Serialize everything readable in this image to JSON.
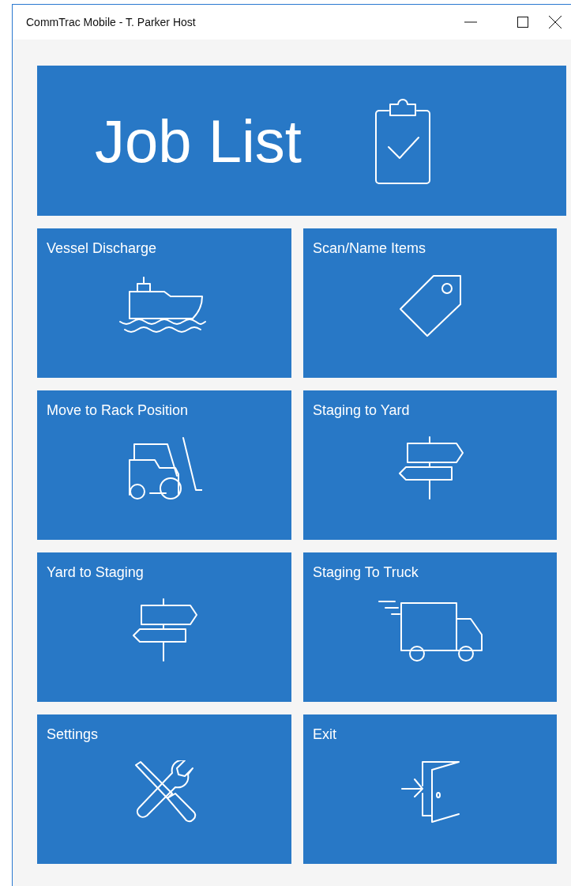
{
  "window": {
    "title": "CommTrac Mobile - T. Parker Host"
  },
  "hero": {
    "label": "Job List",
    "kind": "clipboard"
  },
  "tiles": [
    {
      "label": "Vessel Discharge",
      "kind": "ship"
    },
    {
      "label": "Scan/Name Items",
      "kind": "tag"
    },
    {
      "label": "Move to Rack Position",
      "kind": "forklift"
    },
    {
      "label": "Staging to Yard",
      "kind": "signpost"
    },
    {
      "label": "Yard to Staging",
      "kind": "signpost"
    },
    {
      "label": "Staging To Truck",
      "kind": "truck"
    },
    {
      "label": "Settings",
      "kind": "tools"
    },
    {
      "label": "Exit",
      "kind": "door"
    }
  ]
}
